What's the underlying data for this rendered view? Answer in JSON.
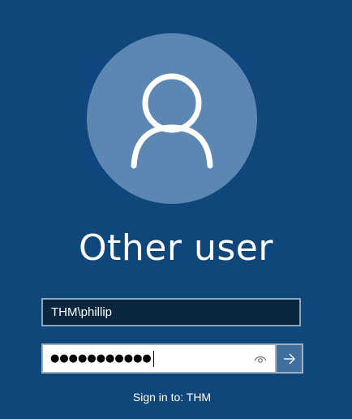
{
  "user": {
    "display_name": "Other user"
  },
  "login": {
    "username_value": "THM\\phillip",
    "password_mask": "●●●●●●●●●●●",
    "sign_in_to": "Sign in to: THM"
  },
  "icons": {
    "avatar": "person-icon",
    "reveal": "eye-icon",
    "submit": "arrow-right-icon"
  },
  "colors": {
    "background": "#10477b",
    "avatar_circle": "#5c87b2",
    "username_field_bg": "#0b2740",
    "submit_button_bg": "#3f6f9d"
  }
}
